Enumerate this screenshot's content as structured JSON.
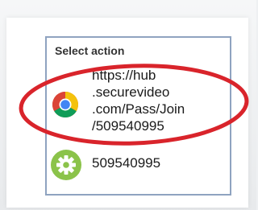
{
  "dialog": {
    "title": "Select action",
    "options": [
      {
        "label": "https://hub\n.securevideo\n.com/Pass/Join\n/509540995",
        "icon": "chrome-icon"
      },
      {
        "label": "509540995",
        "icon": "settings-gear-icon"
      }
    ]
  },
  "colors": {
    "dialog_border": "#8fa3c0",
    "highlight": "#d9242b",
    "gear_green": "#8bc34a",
    "chrome_red": "#db4437",
    "chrome_yellow": "#f4c20d",
    "chrome_green": "#0f9d58",
    "chrome_blue": "#4285f4"
  }
}
